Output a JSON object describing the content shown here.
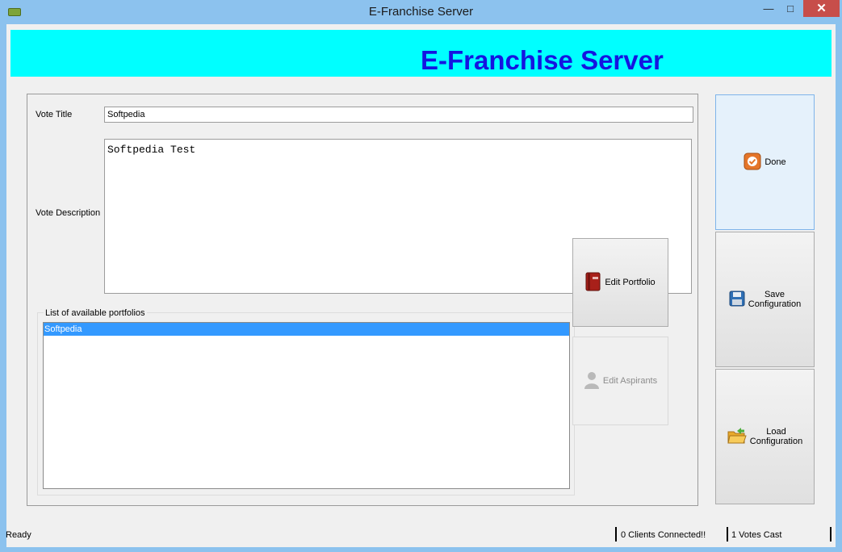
{
  "window": {
    "title": "E-Franchise Server",
    "minimize_glyph": "—",
    "maximize_glyph": "□",
    "close_glyph": "✕"
  },
  "banner": {
    "title": "E-Franchise Server"
  },
  "form": {
    "vote_title_label": "Vote Title",
    "vote_title_value": "Softpedia",
    "vote_description_label": "Vote Description",
    "vote_description_value": "Softpedia Test"
  },
  "portfolios": {
    "caption": "List of available portfolios",
    "items": [
      {
        "label": "Softpedia",
        "selected": true
      }
    ]
  },
  "buttons": {
    "edit_portfolio": "Edit Portfolio",
    "edit_aspirants": "Edit Aspirants",
    "done": "Done",
    "save_configuration_line1": "Save",
    "save_configuration_line2": "Configuration",
    "load_configuration_line1": "Load",
    "load_configuration_line2": "Configuration"
  },
  "status": {
    "ready": "Ready",
    "clients_connected": "0 Clients Connected!!",
    "votes_cast": "1 Votes Cast"
  },
  "colors": {
    "banner_bg": "#00ffff",
    "banner_text": "#1515e0",
    "selection": "#3399ff",
    "close_button": "#c74e4a"
  }
}
